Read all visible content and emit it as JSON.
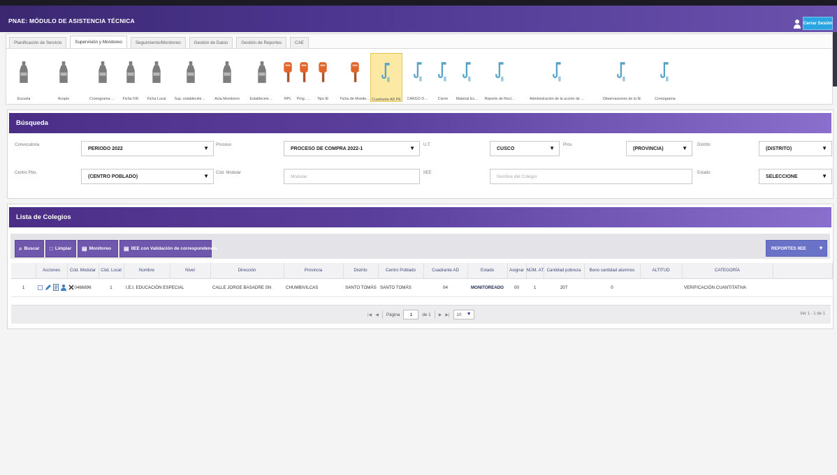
{
  "app": {
    "title": "PNAE: MÓDULO DE ASISTENCIA TÉCNICA",
    "logout_label": "Cerrar Sesión",
    "user_icon": "user-icon"
  },
  "colors": {
    "header": "#4c3690",
    "panel_header": "#5b3f9c",
    "logout": "#2aa5e3",
    "icon_gray": "#7d7d7d",
    "icon_orange": "#e2662c",
    "icon_blue": "#58a2c8",
    "selected_bg": "#fbe9a4"
  },
  "tabs": [
    {
      "label": "Planificación de Servicio",
      "active": false
    },
    {
      "label": "Supervisión y Monitoreo",
      "active": true
    },
    {
      "label": "Seguimiento/Monitoreo",
      "active": false
    },
    {
      "label": "Gestión de Datos",
      "active": false
    },
    {
      "label": "Gestión de Reportes",
      "active": false
    },
    {
      "label": "CAE",
      "active": false
    }
  ],
  "toolbar": {
    "items": [
      {
        "label": "Escuela",
        "icon": "bottle-icon",
        "color": "#7d7d7d"
      },
      {
        "label": "Acopio",
        "icon": "bottle-icon",
        "color": "#7d7d7d"
      },
      {
        "label": "Cronograma Entrega",
        "icon": "bottle-icon",
        "color": "#7d7d7d"
      },
      {
        "label": "Ficha IVE",
        "icon": "bottle-icon",
        "color": "#7d7d7d"
      },
      {
        "label": "Ficha Local",
        "icon": "bottle-icon",
        "color": "#7d7d7d"
      },
      {
        "label": "Sup. establecimiento",
        "icon": "bottle-icon",
        "color": "#7d7d7d"
      },
      {
        "label": "Acta Monitoreo",
        "icon": "bottle-icon",
        "color": "#7d7d7d"
      },
      {
        "label": "Establecimiento",
        "icon": "bottle-icon",
        "color": "#7d7d7d"
      },
      {
        "label": "RPL",
        "icon": "sign-icon",
        "color": "#e2662c"
      },
      {
        "label": "Prog. DIE",
        "icon": "sign-icon",
        "color": "#e2662c"
      },
      {
        "label": "Tipo IE",
        "icon": "sign-icon",
        "color": "#e2662c"
      },
      {
        "label": "Ficha de Monitoreo",
        "icon": "sign-icon",
        "color": "#e2662c"
      },
      {
        "label": "Cuadrante AD PE",
        "icon": "cup-icon",
        "color": "#58a2c8",
        "selected": true
      },
      {
        "label": "CARGO DE IE",
        "icon": "cup-icon",
        "color": "#58a2c8"
      },
      {
        "label": "Cierre",
        "icon": "cup-icon",
        "color": "#58a2c8"
      },
      {
        "label": "Material Escolar",
        "icon": "cup-icon",
        "color": "#58a2c8"
      },
      {
        "label": "Reporte de Reclamo",
        "icon": "cup-icon",
        "color": "#58a2c8"
      },
      {
        "label": "Administración de la acción de monitoreo",
        "icon": "cup-icon",
        "color": "#58a2c8"
      },
      {
        "label": "Observaciones de la IE",
        "icon": "cup-icon",
        "color": "#58a2c8"
      },
      {
        "label": "Cronograma",
        "icon": "cup-icon",
        "color": "#58a2c8"
      }
    ]
  },
  "search": {
    "title": "Búsqueda",
    "convocatoria": {
      "label": "Convocatoria",
      "value": "PERIODO 2022"
    },
    "proceso": {
      "label": "Proceso",
      "value": "PROCESO DE COMPRA 2022-1"
    },
    "ut": {
      "label": "U.T.",
      "value": "CUSCO"
    },
    "provincia": {
      "label": "Prov.",
      "value": "(PROVINCIA)"
    },
    "distrito": {
      "label": "Distrito",
      "value": "(DISTRITO)"
    },
    "centro_poblado": {
      "label": "Centro Pbo.",
      "value": "(CENTRO POBLADO)"
    },
    "cod_modular": {
      "label": "Cód. Modular",
      "placeholder": "Modular"
    },
    "iiee": {
      "label": "IIEE",
      "placeholder": "Nombre del Colegio"
    },
    "estado": {
      "label": "Estado",
      "value": "SELECCIONE"
    }
  },
  "list": {
    "title": "Lista de Colegios",
    "buttons": {
      "search": "Buscar",
      "clear": "Limpiar",
      "monitor": "Monitoreo",
      "validated": "IIEE con Validación de correspondencia"
    },
    "reports_label": "REPORTES IIEE",
    "columns": [
      "Acciones",
      "Cód. Modular",
      "Cód. Local",
      "Nombre",
      "Nivel",
      "Dirección",
      "Provincia",
      "Distrito",
      "Centro Poblado",
      "Cuadrante AD",
      "Estado",
      "Asignar",
      "NÚM. AT",
      "Cantidad pobreza",
      "Bono cantidad alumnos",
      "ALTITUD",
      "CATEGORÍA"
    ],
    "rows": [
      {
        "number": "1",
        "cells": [
          "0466896",
          "1",
          "I.E.I. EDUCACIÓN ESPECIAL",
          "",
          "CALLE JORGE BASADRE SN",
          "CHUMBIVILCAS",
          "SANTO TOMÁS",
          "SANTO TOMÁS",
          "04",
          "MONITOREADO",
          "00",
          "1",
          "207",
          "0",
          "",
          "VERIFICACIÓN CUANTITATIVA"
        ]
      }
    ],
    "pager": {
      "page_label": "Página",
      "page": "1",
      "of_label": "de 1",
      "page_size": "10",
      "summary": "Ver 1 - 1 de 1"
    }
  }
}
